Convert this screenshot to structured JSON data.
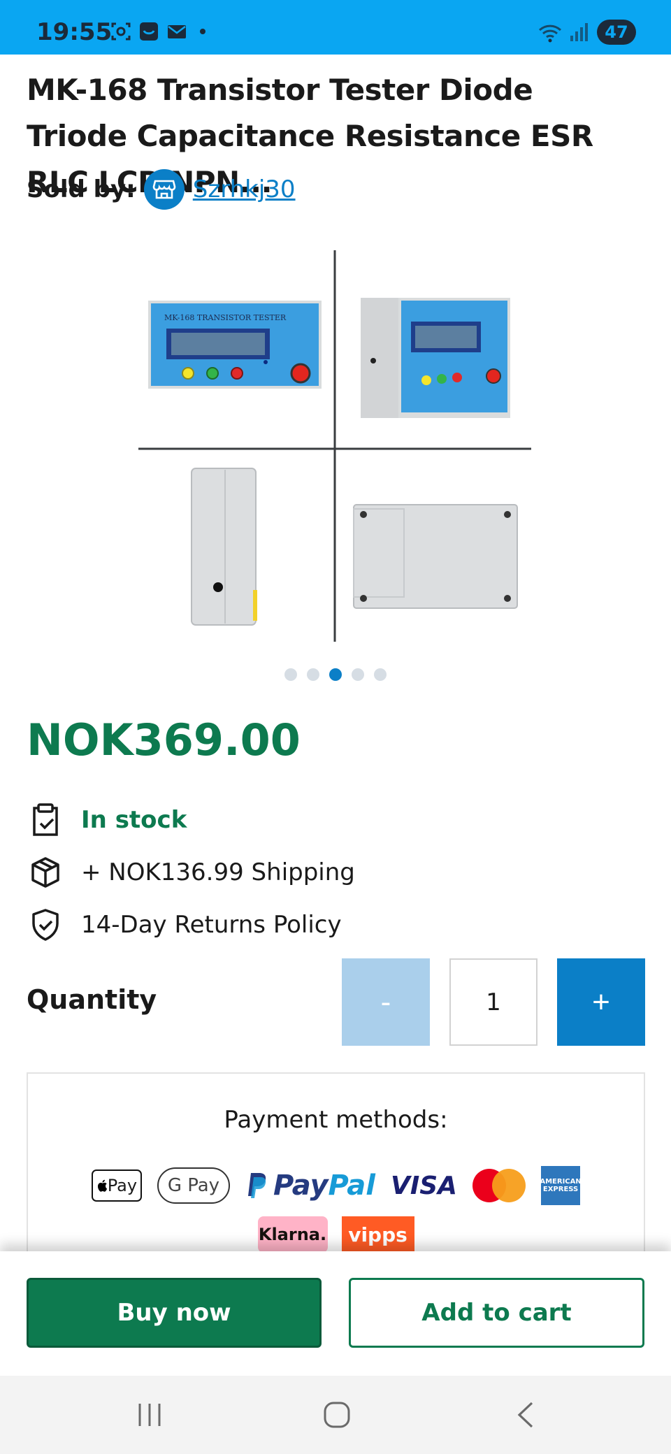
{
  "status_bar": {
    "time": "19:55",
    "battery": "47",
    "icons": [
      "screenshot-icon",
      "app-icon",
      "mail-icon",
      "wifi-icon",
      "signal-icon"
    ]
  },
  "product": {
    "title": "MK-168 Transistor Tester Diode Triode Capacitance Resistance ESR RLC LCR NPN...",
    "sold_by_label": "Sold by:",
    "seller": "Szrhkj30",
    "image_label": "MK-168 TRANSISTOR TESTER",
    "carousel": {
      "count": 5,
      "active_index": 2
    },
    "price": "NOK369.00",
    "stock": "In stock",
    "shipping": "+ NOK136.99 Shipping",
    "returns": "14-Day Returns Policy"
  },
  "quantity": {
    "label": "Quantity",
    "minus": "-",
    "value": "1",
    "plus": "+"
  },
  "payment": {
    "title": "Payment methods:",
    "methods": [
      "Apple Pay",
      "Google Pay",
      "PayPal",
      "VISA",
      "Mastercard",
      "American Express",
      "Klarna.",
      "vipps"
    ],
    "apple_pay_text": "Pay",
    "google_pay_text": "G Pay",
    "paypal_text_1": "Pay",
    "paypal_text_2": "Pal",
    "visa_text": "VISA",
    "amex_text": "AMERICAN EXPRESS",
    "klarna_text": "Klarna.",
    "vipps_text": "vipps"
  },
  "actions": {
    "buy_now": "Buy now",
    "add_to_cart": "Add to cart"
  },
  "colors": {
    "status_bar": "#0aa6f2",
    "brand_green": "#0d7a4f",
    "brand_blue": "#0b7fc7",
    "minus_disabled": "#aacfeb"
  }
}
